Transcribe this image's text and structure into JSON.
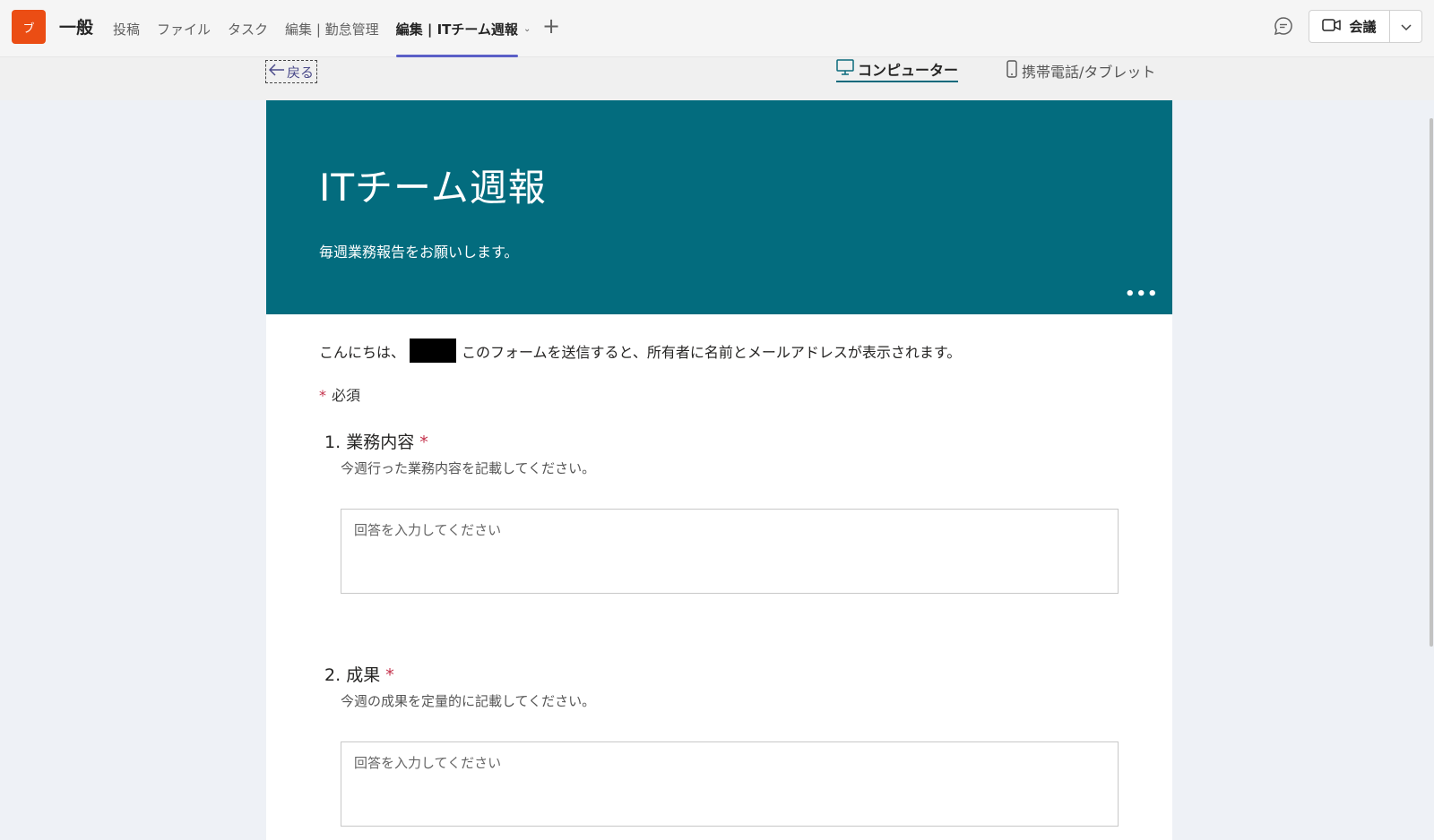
{
  "topbar": {
    "app_icon_label": "ブ",
    "channel_name": "一般",
    "tabs": [
      {
        "label": "投稿"
      },
      {
        "label": "ファイル"
      },
      {
        "label": "タスク"
      },
      {
        "label": "編集 | 勤怠管理"
      },
      {
        "label": "編集 | ITチーム週報",
        "active": true
      }
    ],
    "add_tab_icon": "plus-icon",
    "chat_icon": "chat-bubble-icon",
    "meet_label": "会議",
    "meet_icon": "video-camera-icon",
    "accent_color": "#5b5fc7"
  },
  "subbar": {
    "back_label": "戻る",
    "view_computer_label": "コンピューター",
    "view_mobile_label": "携帯電話/タブレット"
  },
  "form": {
    "title": "ITチーム週報",
    "description": "毎週業務報告をお願いします。",
    "banner_color": "#036c7e",
    "greeting_prefix": "こんにちは、",
    "greeting_suffix": "このフォームを送信すると、所有者に名前とメールアドレスが表示されます。",
    "required_note": "必須",
    "questions": [
      {
        "number": "1.",
        "title": "業務内容",
        "subtitle": "今週行った業務内容を記載してください。",
        "placeholder": "回答を入力してください"
      },
      {
        "number": "2.",
        "title": "成果",
        "subtitle": "今週の成果を定量的に記載してください。",
        "placeholder": "回答を入力してください"
      }
    ]
  }
}
